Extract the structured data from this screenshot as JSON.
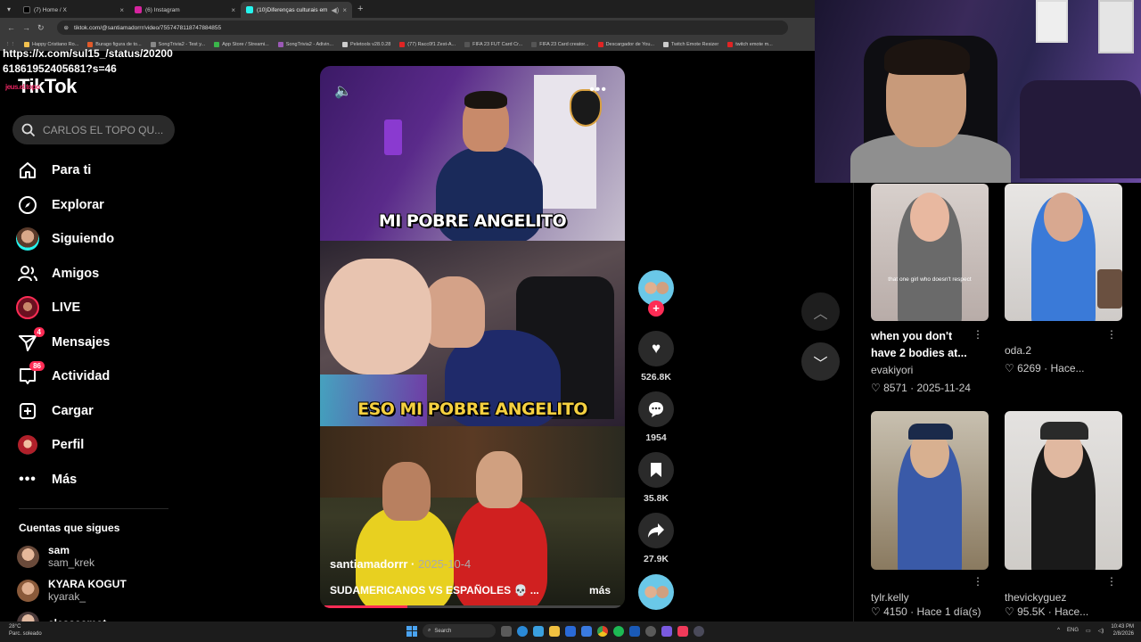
{
  "browser": {
    "tabs": [
      {
        "label": "(7) Home / X",
        "color": "#000000"
      },
      {
        "label": "(6) Instagram",
        "color": "#d6249f"
      },
      {
        "label": "(10)Diferenças culturais em...",
        "color": "#25f4ee"
      }
    ],
    "new_tab": "+",
    "url": "tiktok.com/@santiamadorrr/video/7557478118747884855",
    "bookmarks": [
      {
        "label": "Happy Cristiano Ro...",
        "color": "#f2c14e"
      },
      {
        "label": "Burago figura de to...",
        "color": "#e05a2a"
      },
      {
        "label": "SongTrivia2 - Test y...",
        "color": "#888888"
      },
      {
        "label": "App Store / Streami...",
        "color": "#3ab54a"
      },
      {
        "label": "SongTrivia2 - Adivin...",
        "color": "#9b59b6"
      },
      {
        "label": "Peletools v28.0.28",
        "color": "#cccccc"
      },
      {
        "label": "(77) Racc0f1 Zest-A...",
        "color": "#e02424"
      },
      {
        "label": "FIFA 23 FUT Card Cr...",
        "color": "#555555"
      },
      {
        "label": "FIFA 23 Card creator...",
        "color": "#555555"
      },
      {
        "label": "Descargador de You...",
        "color": "#e02424"
      },
      {
        "label": "Twitch Emote Resizer",
        "color": "#cccccc"
      },
      {
        "label": "twitch emote m...",
        "color": "#e02424"
      }
    ]
  },
  "overlay_url": {
    "line1": "https://x.com/sul15_/status/20200",
    "line2": "61861952405681?s=46"
  },
  "sidebar": {
    "logo": "TikTok",
    "logo_tag": "jeus.el.topo",
    "search_placeholder": "CARLOS EL TOPO QU...",
    "items": [
      {
        "label": "Para ti",
        "icon": "home-icon"
      },
      {
        "label": "Explorar",
        "icon": "compass-icon"
      },
      {
        "label": "Siguiendo",
        "icon": "avatar-icon"
      },
      {
        "label": "Amigos",
        "icon": "friends-icon"
      },
      {
        "label": "LIVE",
        "icon": "live-icon"
      },
      {
        "label": "Mensajes",
        "icon": "send-icon",
        "badge": "4"
      },
      {
        "label": "Actividad",
        "icon": "inbox-icon",
        "badge": "86"
      },
      {
        "label": "Cargar",
        "icon": "plus-square-icon"
      },
      {
        "label": "Perfil",
        "icon": "profile-icon"
      },
      {
        "label": "Más",
        "icon": "more-icon"
      }
    ],
    "following_title": "Cuentas que sigues",
    "following": [
      {
        "name": "sam",
        "user": "sam_krek"
      },
      {
        "name": "KYARA KOGUT",
        "user": "kyarak_"
      },
      {
        "name": "alessaamot",
        "user": ""
      }
    ]
  },
  "video": {
    "caption_top": "MI POBRE ANGELITO",
    "caption_mid": "ESO MI POBRE ANGELITO",
    "author": "santiamadorrr",
    "date": "2025-10-4",
    "description": "SUDAMERICANOS VS ESPAÑOLES 💀 ...",
    "more": "más",
    "progress": 0.28
  },
  "actions": {
    "likes": "526.8K",
    "comments": "1954",
    "saves": "35.8K",
    "shares": "27.9K"
  },
  "grid": [
    {
      "title": "when you don't have 2 bodies at...",
      "user": "evakiyori",
      "likes": "8571",
      "date": "2025-11-24"
    },
    {
      "title": "",
      "user": "oda.2",
      "likes": "6269",
      "date": "Hace..."
    },
    {
      "title": "",
      "user": "tylr.kelly",
      "likes": "4150",
      "date": "Hace 1 día(s)"
    },
    {
      "title": "",
      "user": "thevickyguez",
      "likes": "95.5K",
      "date": "Hace..."
    }
  ],
  "grid_thumb_text": "that one girl who doesn't respect",
  "taskbar": {
    "temp": "28°C",
    "weather": "Parc. soleado",
    "search": "Search",
    "lang": "ENG",
    "time": "10:43 PM",
    "date": "2/8/2026"
  }
}
